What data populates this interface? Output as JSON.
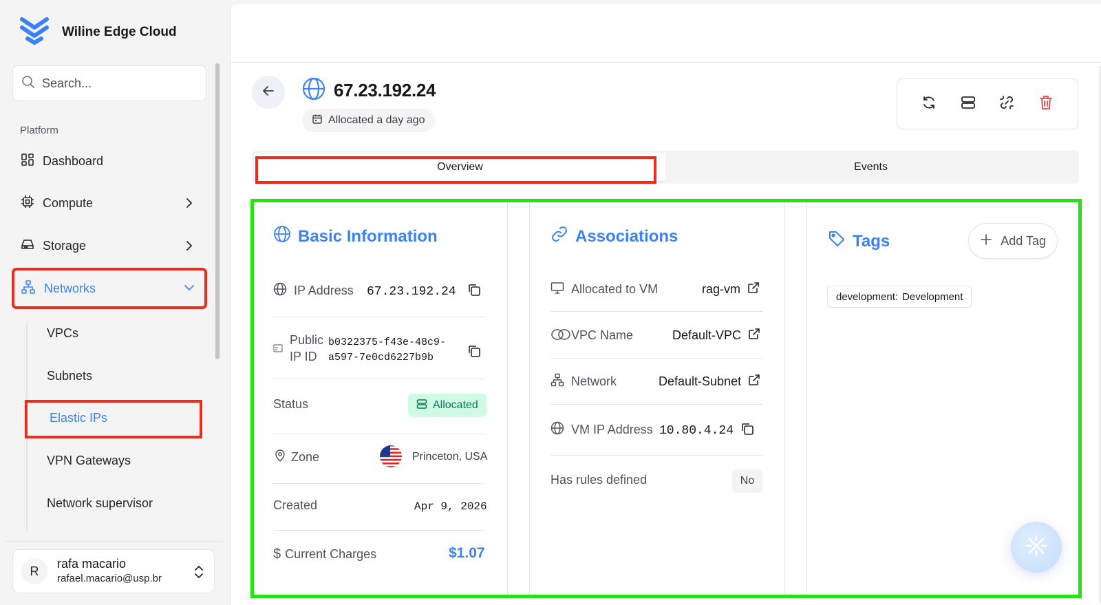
{
  "brand": {
    "name": "Wiline Edge Cloud"
  },
  "search": {
    "placeholder": "Search..."
  },
  "sidebar": {
    "section_label": "Platform",
    "items": [
      {
        "label": "Dashboard",
        "icon": "dashboard-icon"
      },
      {
        "label": "Compute",
        "icon": "cpu-icon"
      },
      {
        "label": "Storage",
        "icon": "storage-icon"
      },
      {
        "label": "Networks",
        "icon": "network-icon"
      }
    ],
    "sub_items": [
      {
        "label": "VPCs"
      },
      {
        "label": "Subnets"
      },
      {
        "label": "Elastic IPs"
      },
      {
        "label": "VPN Gateways"
      },
      {
        "label": "Network supervisor"
      }
    ]
  },
  "user": {
    "initial": "R",
    "name": "rafa macario",
    "email": "rafael.macario@usp.br"
  },
  "header": {
    "title": "67.23.192.24",
    "allocated_label": "Allocated a day ago"
  },
  "tabs": [
    {
      "label": "Overview"
    },
    {
      "label": "Events"
    }
  ],
  "basic_info": {
    "title": "Basic Information",
    "ip_address_label": "IP Address",
    "ip_address_value": "67.23.192.24",
    "public_ip_id_label_1": "Public",
    "public_ip_id_label_2": "IP ID",
    "public_ip_id_value_1": "b0322375-f43e-48c9-",
    "public_ip_id_value_2": "a597-7e0cd6227b9b",
    "status_label": "Status",
    "status_value": "Allocated",
    "zone_label": "Zone",
    "zone_value": "Princeton, USA",
    "created_label": "Created",
    "created_value": "Apr 9, 2026",
    "charges_label": "Current Charges",
    "charges_value": "$1.07"
  },
  "associations": {
    "title": "Associations",
    "vm_label": "Allocated to VM",
    "vm_value": "rag-vm",
    "vpc_label": "VPC Name",
    "vpc_value": "Default-VPC",
    "network_label": "Network",
    "network_value": "Default-Subnet",
    "vm_ip_label": "VM IP Address",
    "vm_ip_value": "10.80.4.24",
    "rules_label": "Has rules defined",
    "rules_value": "No"
  },
  "tags": {
    "title": "Tags",
    "add_label": "Add Tag",
    "items": [
      {
        "key": "development:",
        "value": "Development"
      }
    ]
  },
  "colors": {
    "accent": "#3b82f6",
    "danger": "#ef4444",
    "highlight_red": "#ef2b1c",
    "highlight_green": "#22e510",
    "success_bg": "#d1fae5"
  }
}
